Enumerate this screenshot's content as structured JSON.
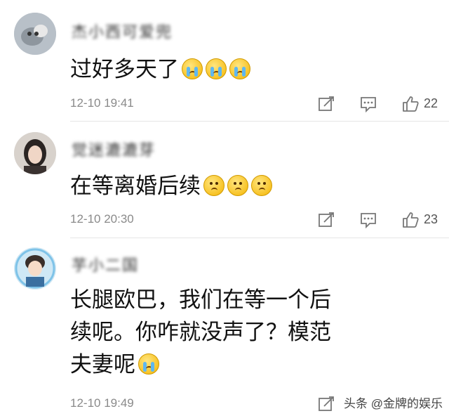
{
  "comments": [
    {
      "username": "杰小西可爱兜",
      "text": "过好多天了",
      "emojis": [
        "crying-face-emoji",
        "crying-face-emoji",
        "crying-face-emoji"
      ],
      "time": "12-10 19:41",
      "likes": "22"
    },
    {
      "username": "觉迷漉漉芽",
      "text": "在等离婚后续",
      "emojis": [
        "pleading-face-emoji",
        "pleading-face-emoji",
        "pleading-face-emoji"
      ],
      "time": "12-10 20:30",
      "likes": "23"
    },
    {
      "username": "芋小二国",
      "text_line1": "长腿欧巴，我们在等一个后",
      "text_line2": "续呢。你咋就没声了？模范",
      "text_line3": "夫妻呢",
      "emojis": [
        "crying-face-emoji"
      ],
      "time": "12-10 19:49",
      "likes": ""
    }
  ],
  "icons": {
    "share": "share-icon",
    "reply": "comment-icon",
    "like": "thumbs-up-icon"
  },
  "watermark": "头条 @金牌的娱乐"
}
